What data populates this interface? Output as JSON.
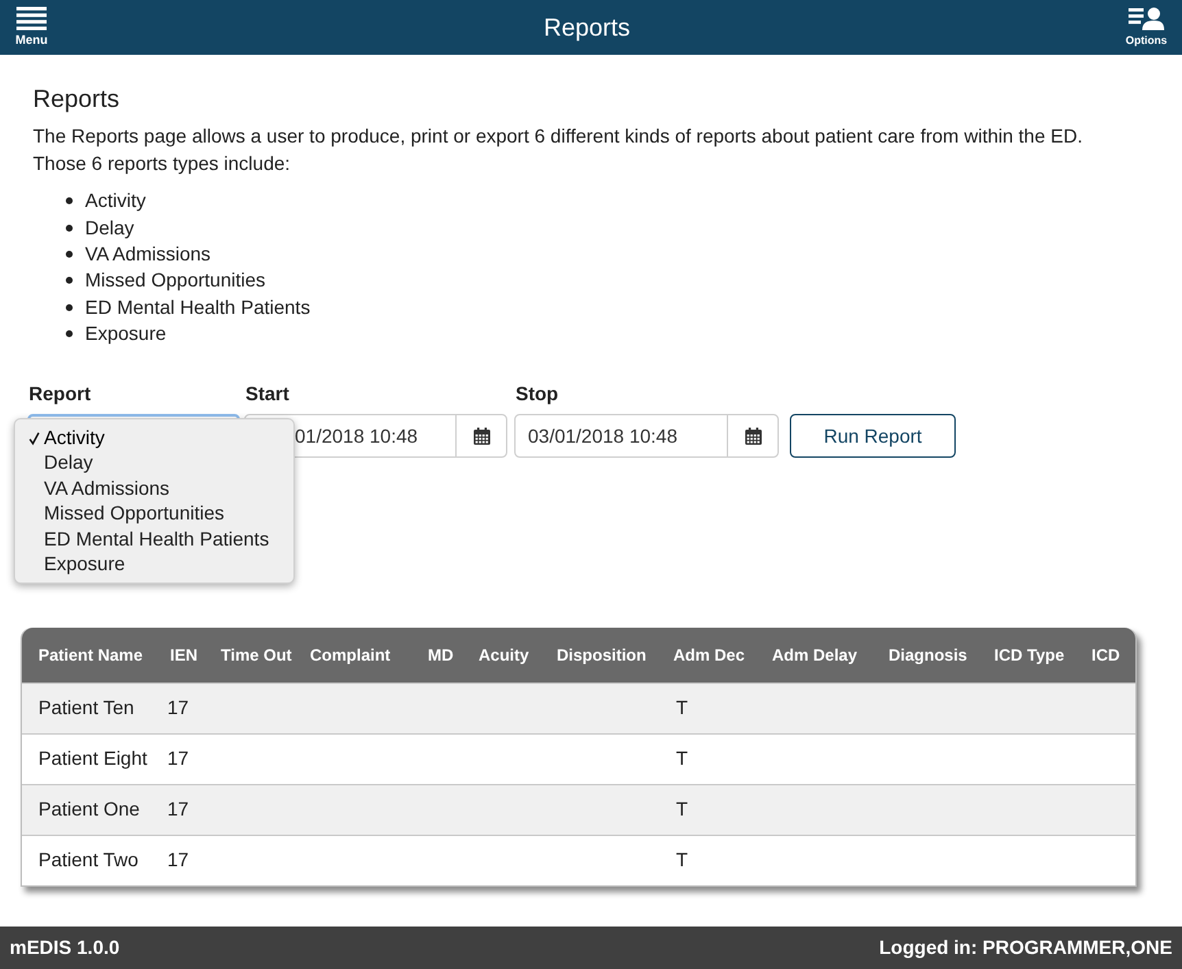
{
  "header": {
    "menu_label": "Menu",
    "title": "Reports",
    "options_label": "Options"
  },
  "intro": {
    "heading": "Reports",
    "paragraph": "The Reports page allows a user to produce, print or export 6 different kinds of reports about patient care from within the ED. Those 6 reports types include:",
    "report_types": [
      "Activity",
      "Delay",
      "VA Admissions",
      "Missed Opportunities",
      "ED Mental Health Patients",
      "Exposure"
    ]
  },
  "form": {
    "report": {
      "label": "Report",
      "options": [
        {
          "label": "Activity",
          "selected": true
        },
        {
          "label": "Delay",
          "selected": false
        },
        {
          "label": "VA Admissions",
          "selected": false
        },
        {
          "label": "Missed Opportunities",
          "selected": false
        },
        {
          "label": "ED Mental Health Patients",
          "selected": false
        },
        {
          "label": "Exposure",
          "selected": false
        }
      ]
    },
    "start": {
      "label": "Start",
      "value": "01/2018 10:48"
    },
    "stop": {
      "label": "Stop",
      "value": "03/01/2018 10:48"
    },
    "run_button": "Run Report"
  },
  "table": {
    "columns": [
      "Patient Name",
      "IEN",
      "Time Out",
      "Complaint",
      "MD",
      "Acuity",
      "Disposition",
      "Adm Dec",
      "Adm Delay",
      "Diagnosis",
      "ICD Type",
      "ICD"
    ],
    "rows": [
      {
        "patient_name": "Patient Ten",
        "ien": "17",
        "adm_dec": "T"
      },
      {
        "patient_name": "Patient Eight",
        "ien": "17",
        "adm_dec": "T"
      },
      {
        "patient_name": "Patient One",
        "ien": "17",
        "adm_dec": "T"
      },
      {
        "patient_name": "Patient Two",
        "ien": "17",
        "adm_dec": "T"
      }
    ]
  },
  "status_bar": {
    "app_version": "mEDIS 1.0.0",
    "logged_in": "Logged in: PROGRAMMER,ONE"
  }
}
